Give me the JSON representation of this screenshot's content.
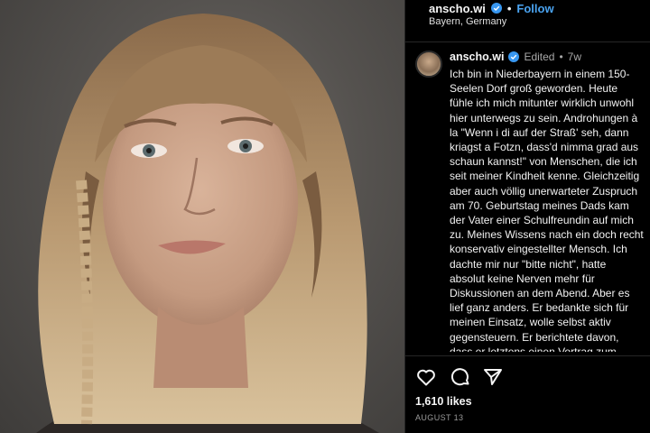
{
  "post": {
    "handle": "anscho.wi",
    "follow_label": "Follow",
    "separator": "•",
    "location": "Bayern, Germany",
    "edited_label": "Edited",
    "age": "7w",
    "caption_lines": [
      "Ich bin in Niederbayern in einem 150-",
      "Seelen Dorf groß geworden. Heute",
      "fühle ich mich mitunter wirklich unwohl",
      "hier unterwegs zu sein. Androhungen à",
      "la \"Wenn i di auf der Straß' seh, dann",
      "kriagst a Fotzn, dass'd nimma grad aus",
      "schaun kannst!\" von Menschen, die ich",
      "seit meiner Kindheit kenne. Gleichzeitig",
      "aber auch völlig unerwarteter Zuspruch",
      "am 70. Geburtstag meines Dads kam",
      "der Vater einer Schulfreundin auf mich",
      "zu. Meines Wissens nach ein doch recht",
      "konservativ eingestellter Mensch. Ich",
      "dachte mir nur \"bitte nicht\", hatte",
      "absolut keine Nerven mehr für",
      "Diskussionen an dem Abend. Aber es",
      "lief ganz anders. Er bedankte sich für",
      "meinen Einsatz, wolle selbst aktiv",
      "gegensteuern. Er berichtete davon,",
      "dass er letztens einen Vortrag zum"
    ],
    "likes": "1,610 likes",
    "date": "AUGUST 13"
  },
  "icons": {
    "verified": "verified-badge-icon",
    "like": "heart-icon",
    "comment": "comment-icon",
    "share": "paper-plane-icon"
  },
  "colors": {
    "background": "#000000",
    "follow": "#4aa3f0",
    "verified": "#3897f0",
    "text": "#f5f5f5",
    "muted": "#a8a8a8"
  }
}
